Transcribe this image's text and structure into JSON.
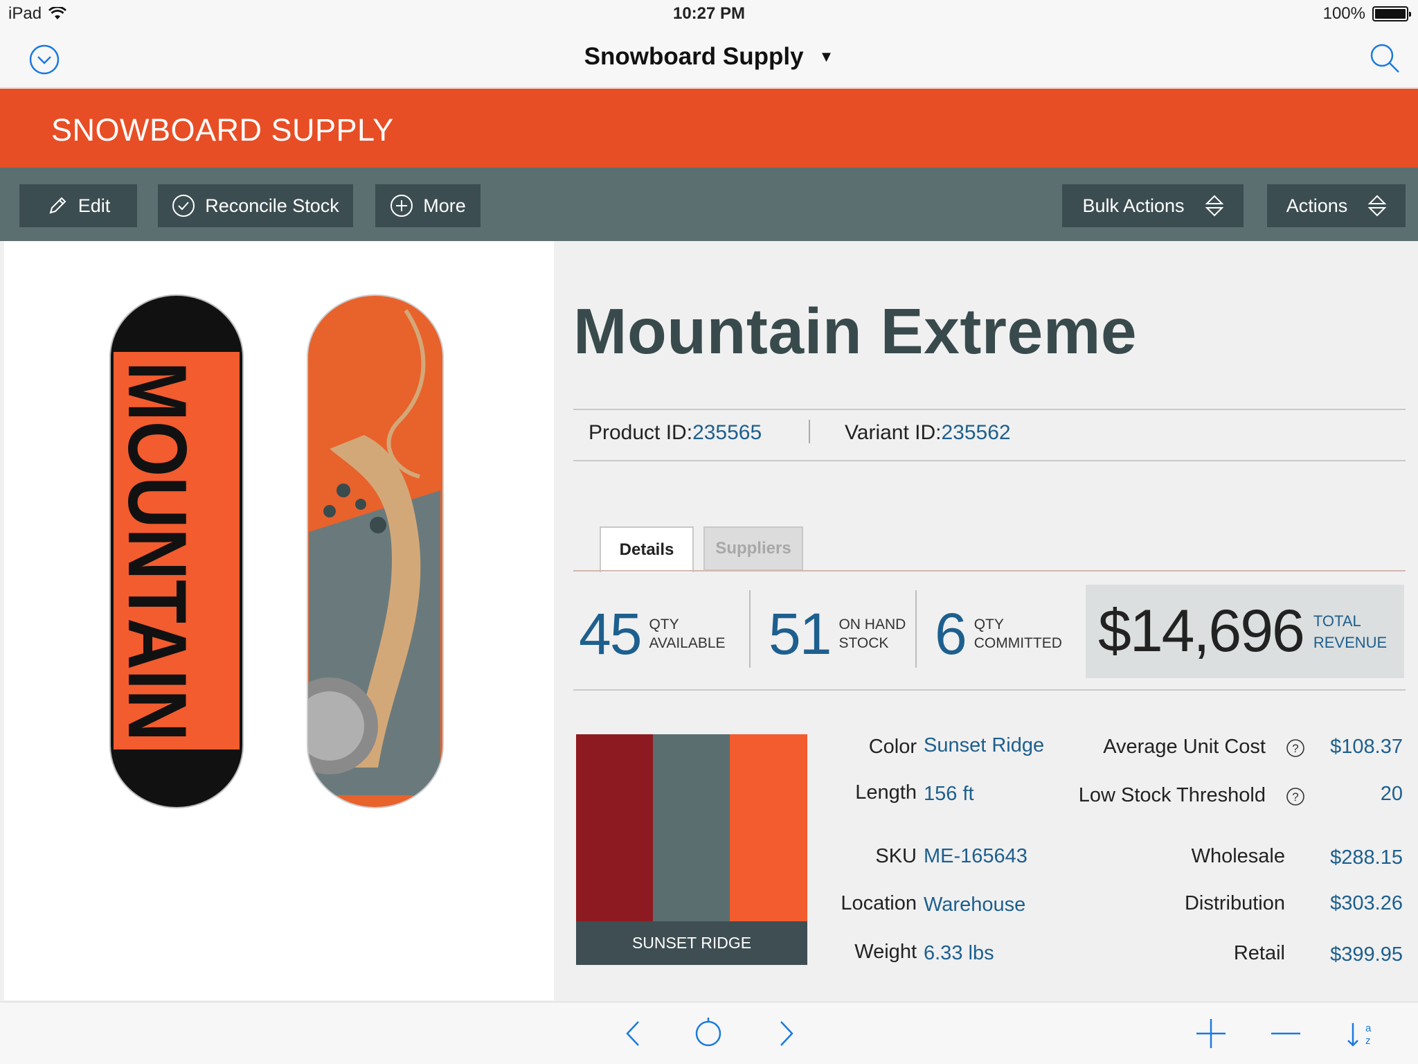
{
  "status_bar": {
    "device": "iPad",
    "time": "10:27 PM",
    "battery": "100%"
  },
  "nav": {
    "title": "Snowboard Supply"
  },
  "brand": {
    "title": "SNOWBOARD SUPPLY",
    "color": "#e84e25"
  },
  "toolbar": {
    "edit": "Edit",
    "reconcile": "Reconcile Stock",
    "more": "More",
    "bulk_actions": "Bulk Actions",
    "actions": "Actions"
  },
  "product": {
    "name": "Mountain Extreme",
    "product_id_label": "Product ID:",
    "product_id": "235565",
    "variant_id_label": "Variant ID:",
    "variant_id": "235562",
    "board_text": "MOUNTAIN"
  },
  "tabs": {
    "details": "Details",
    "suppliers": "Suppliers"
  },
  "stats": {
    "qty_available": {
      "value": "45",
      "label1": "QTY",
      "label2": "AVAILABLE"
    },
    "on_hand": {
      "value": "51",
      "label1": "ON HAND",
      "label2": "STOCK"
    },
    "committed": {
      "value": "6",
      "label1": "QTY",
      "label2": "COMMITTED"
    },
    "revenue": {
      "value": "$14,696",
      "label1": "TOTAL",
      "label2": "REVENUE"
    }
  },
  "swatch": {
    "caption": "SUNSET RIDGE",
    "colors": [
      "#8e1a21",
      "#5a6e70",
      "#f25c2e"
    ]
  },
  "attributes": {
    "color_label": "Color",
    "color_value": "Sunset Ridge",
    "length_label": "Length",
    "length_value": "156 ft",
    "sku_label": "SKU",
    "sku_value": "ME-165643",
    "location_label": "Location",
    "location_value": "Warehouse",
    "weight_label": "Weight",
    "weight_value": "6.33 lbs"
  },
  "pricing": {
    "avg_cost_label": "Average Unit Cost",
    "avg_cost_value": "$108.37",
    "low_stock_label": "Low Stock Threshold",
    "low_stock_value": "20",
    "wholesale_label": "Wholesale",
    "wholesale_value": "$288.15",
    "distribution_label": "Distribution",
    "distribution_value": "$303.26",
    "retail_label": "Retail",
    "retail_value": "$399.95"
  },
  "icons": {
    "nav_left": "chevron-down-circle-icon",
    "nav_right": "search-icon",
    "bottom": [
      "chevron-left-icon",
      "circle-icon",
      "chevron-right-icon",
      "plus-icon",
      "minus-icon",
      "sort-az-icon"
    ]
  },
  "accent": "#1d5f8e"
}
